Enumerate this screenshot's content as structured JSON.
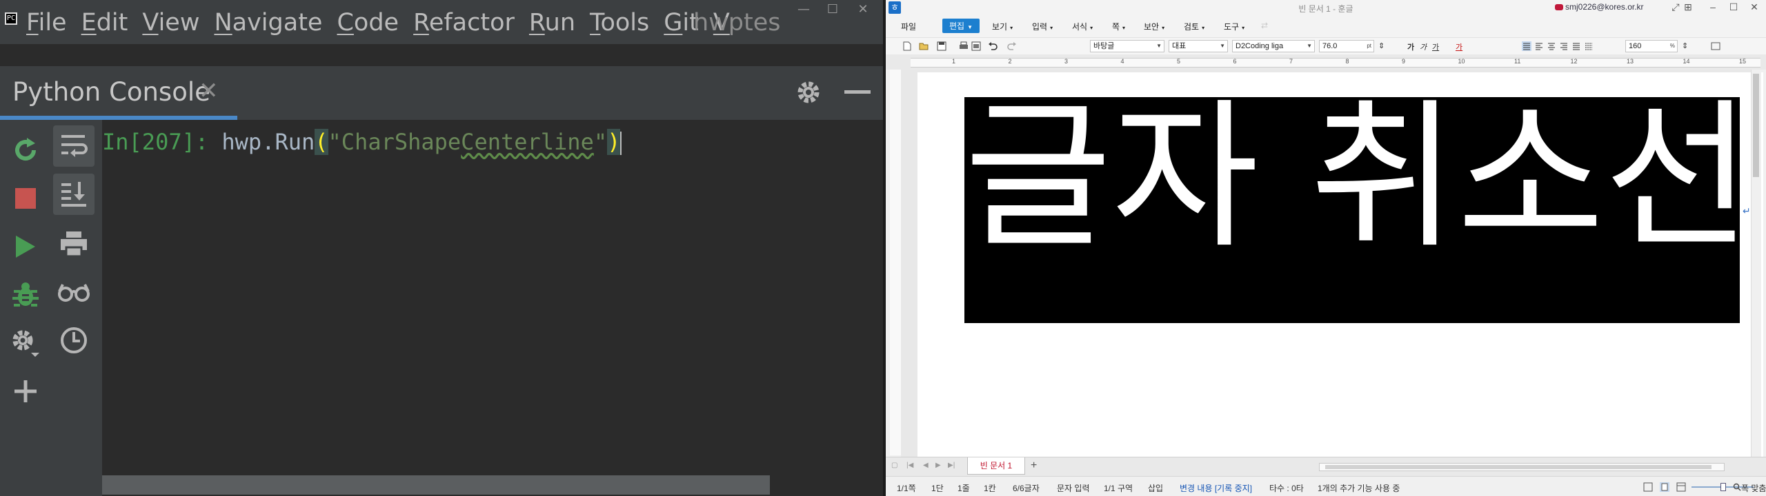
{
  "ide": {
    "project_title": "hwptest",
    "menu": [
      {
        "mn": "F",
        "rest": "ile"
      },
      {
        "mn": "E",
        "rest": "dit"
      },
      {
        "mn": "V",
        "rest": "iew"
      },
      {
        "mn": "N",
        "rest": "avigate"
      },
      {
        "mn": "C",
        "rest": "ode"
      },
      {
        "mn": "R",
        "rest": "efactor"
      },
      {
        "mn": "",
        "rest": "Run"
      },
      {
        "mn": "",
        "rest": "Tools"
      },
      {
        "mn": "",
        "rest": "Git"
      },
      {
        "mn": "V",
        "rest": ""
      }
    ],
    "menu_run_mn": "R",
    "menu_run_rest": "un",
    "menu_tools_mn": "T",
    "menu_tools_rest": "ools",
    "menu_git_mn": "G",
    "menu_git_rest": "it",
    "console_tab_title": "Python Console",
    "console_tab_close": "✕",
    "prompt": "In[207]:",
    "code_call": "hwp.Run",
    "code_open": "(",
    "code_str_q1": "\"",
    "code_str_a": "CharShape",
    "code_str_b": "Centerline",
    "code_str_q2": "\"",
    "code_close": ")"
  },
  "hwp": {
    "window_title": "빈 문서 1 - 훈글",
    "account": "smj0226@kores.or.kr",
    "menus": [
      "파일",
      "편집",
      "보기",
      "입력",
      "서식",
      "쪽",
      "보안",
      "검토",
      "도구"
    ],
    "style_box": "바탕글",
    "lang_box": "대표",
    "font_box": "D2Coding liga",
    "size_box": "76.0",
    "size_unit": "pt",
    "zoom_box": "160",
    "zoom_unit": "%",
    "format_glyphs": [
      "가",
      "가",
      "가",
      "가"
    ],
    "ruler_nums": [
      "1",
      "2",
      "3",
      "4",
      "5",
      "6",
      "7",
      "8",
      "9",
      "10",
      "11",
      "12",
      "13",
      "14",
      "15"
    ],
    "doc_text": "글자 취소선",
    "doc_tab": "빈 문서 1",
    "add_tab": "+",
    "status": {
      "page": "1/1쪽",
      "section": "1단",
      "line": "1줄",
      "column": "1칸",
      "chars": "6/6글자",
      "input_mode": "문자 입력",
      "area": "1/1 구역",
      "insert": "삽입",
      "track_changes": "변경 내용 [기록 중지]",
      "count": "타수 : 0타",
      "extra": "1개의 추가 기능 사용 중",
      "fit": "폭 맞춤"
    }
  },
  "colors": {
    "ide_bg": "#2b2b2b",
    "ide_panel": "#3c3f41",
    "ide_accent": "#4a88c7",
    "prompt_green": "#499c54",
    "string_green": "#6a8759",
    "paren_yellow": "#ffef28",
    "hwp_accent": "#1c7fcf"
  }
}
